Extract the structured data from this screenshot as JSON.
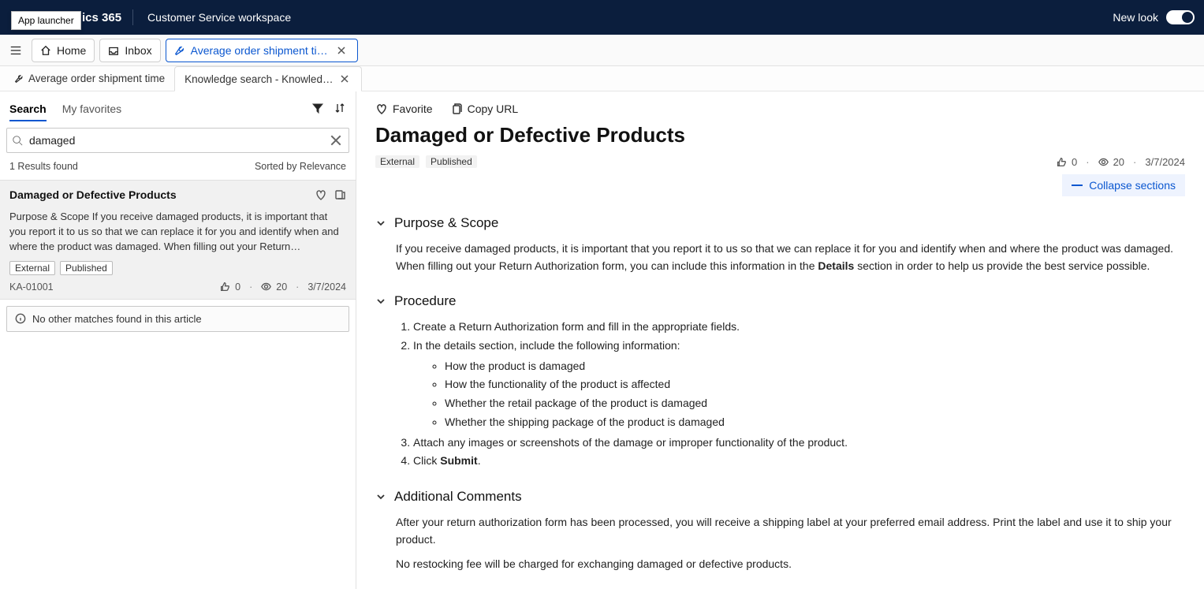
{
  "topbar": {
    "app_launcher_tooltip": "App launcher",
    "brand": "Dynamics 365",
    "brand_visible_fragment": "ics 365",
    "workspace": "Customer Service workspace",
    "new_look_label": "New look"
  },
  "app_tabs": {
    "home": "Home",
    "inbox": "Inbox",
    "active": "Average order shipment ti…"
  },
  "sub_tabs": {
    "first": "Average order shipment time",
    "second": "Knowledge search - Knowled…"
  },
  "sidebar": {
    "tabs": {
      "search": "Search",
      "favorites": "My favorites"
    },
    "search_value": "damaged",
    "results_count": "1 Results found",
    "sorted_by": "Sorted by Relevance",
    "no_more": "No other matches found in this article",
    "result": {
      "title": "Damaged or Defective Products",
      "snippet": "Purpose & Scope If you receive damaged products, it is important that you report it to us so that we can replace it for you and identify when and where the product was damaged. When filling out your Return…",
      "badge_external": "External",
      "badge_published": "Published",
      "id": "KA-01001",
      "likes": "0",
      "views": "20",
      "date": "3/7/2024"
    }
  },
  "article": {
    "favorite": "Favorite",
    "copy_url": "Copy URL",
    "title": "Damaged or Defective Products",
    "badge_external": "External",
    "badge_published": "Published",
    "likes": "0",
    "views": "20",
    "date": "3/7/2024",
    "collapse": "Collapse sections",
    "sections": {
      "purpose": {
        "title": "Purpose & Scope",
        "body_lead": "If you receive damaged products, it is important that you report it to us so that we can replace it for you and identify when and where the product was damaged. When filling out your Return Authorization form, you can include this information in the ",
        "body_strong": "Details",
        "body_tail": " section in order to help us provide the best service possible."
      },
      "procedure": {
        "title": "Procedure",
        "step1": "Create a Return Authorization form and fill in the appropriate fields.",
        "step2": "In the details section, include the following information:",
        "sub1": "How the product is damaged",
        "sub2": "How the functionality of the product is affected",
        "sub3": "Whether the retail package of the product is damaged",
        "sub4": "Whether the shipping package of the product is damaged",
        "step3": "Attach any images or screenshots of the damage or improper functionality of the product.",
        "step4_lead": "Click ",
        "step4_strong": "Submit",
        "step4_tail": "."
      },
      "comments": {
        "title": "Additional Comments",
        "para1": "After your return authorization form has been processed, you will receive a shipping label at your preferred email address. Print the label and use it to ship your product.",
        "para2": "No restocking fee will be charged for exchanging damaged or defective products."
      }
    }
  }
}
